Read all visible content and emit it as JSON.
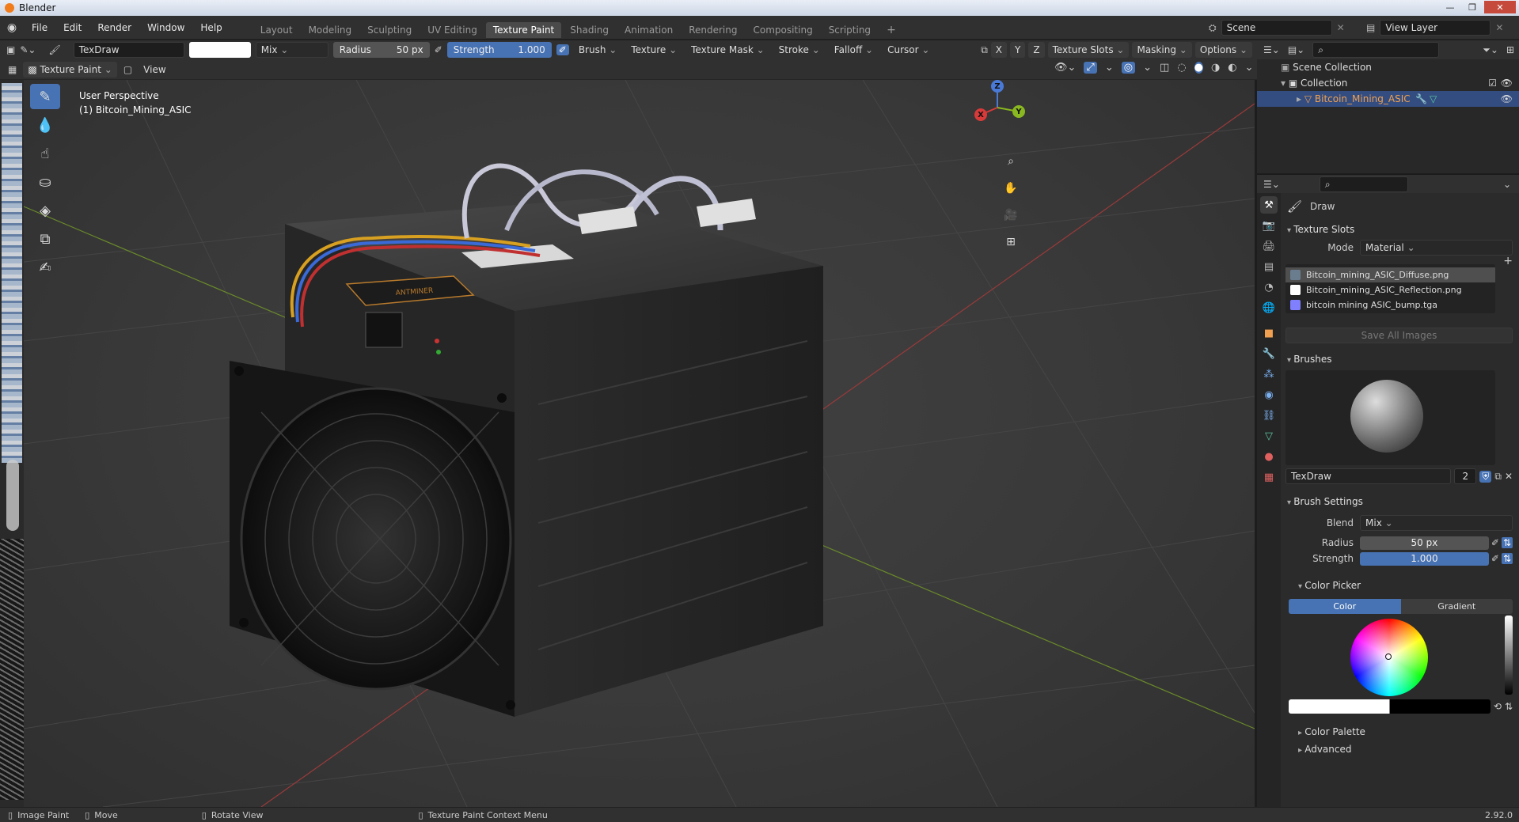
{
  "app": {
    "title": "Blender",
    "version": "2.92.0"
  },
  "window_buttons": [
    "—",
    "❐",
    "✕"
  ],
  "menu": [
    "File",
    "Edit",
    "Render",
    "Window",
    "Help"
  ],
  "workspaces": [
    "Layout",
    "Modeling",
    "Sculpting",
    "UV Editing",
    "Texture Paint",
    "Shading",
    "Animation",
    "Rendering",
    "Compositing",
    "Scripting"
  ],
  "active_workspace": "Texture Paint",
  "scene": "Scene",
  "view_layer": "View Layer",
  "tool_header": {
    "brush_name": "TexDraw",
    "blend": "Mix",
    "radius_label": "Radius",
    "radius_value": "50 px",
    "strength_label": "Strength",
    "strength_value": "1.000",
    "menus": [
      "Brush",
      "Texture",
      "Texture Mask",
      "Stroke",
      "Falloff",
      "Cursor"
    ],
    "axes": [
      "X",
      "Y",
      "Z"
    ],
    "right_menus": [
      "Texture Slots",
      "Masking",
      "Options"
    ]
  },
  "mode_header": {
    "mode": "Texture Paint",
    "view": "View"
  },
  "viewport": {
    "perspective": "User Perspective",
    "object_label": "(1) Bitcoin_Mining_ASIC",
    "brand_plate": "ANTMINER",
    "gizmo_axes": {
      "x": "X",
      "y": "Y",
      "z": "Z"
    }
  },
  "outliner": {
    "scene_collection": "Scene Collection",
    "collection": "Collection",
    "object": "Bitcoin_Mining_ASIC"
  },
  "properties": {
    "tool_name": "Draw",
    "texture_slots": {
      "title": "Texture Slots",
      "mode_label": "Mode",
      "mode_value": "Material",
      "slots": [
        {
          "name": "Bitcoin_mining_ASIC_Diffuse.png",
          "color": "#6a7d8f"
        },
        {
          "name": "Bitcoin_mining_ASIC_Reflection.png",
          "color": "#ffffff"
        },
        {
          "name": "bitcoin mining ASIC_bump.tga",
          "color": "#8080ff"
        }
      ],
      "save_all": "Save All Images"
    },
    "brushes": {
      "title": "Brushes",
      "name": "TexDraw",
      "users": "2"
    },
    "brush_settings": {
      "title": "Brush Settings",
      "blend_label": "Blend",
      "blend_value": "Mix",
      "radius_label": "Radius",
      "radius_value": "50 px",
      "strength_label": "Strength",
      "strength_value": "1.000"
    },
    "color_picker": {
      "title": "Color Picker",
      "tab_color": "Color",
      "tab_gradient": "Gradient"
    },
    "color_palette": "Color Palette",
    "advanced": "Advanced"
  },
  "statusbar": {
    "items": [
      "Image Paint",
      "Move",
      "Rotate View",
      "Texture Paint Context Menu"
    ]
  },
  "colors": {
    "accent": "#4772b3",
    "selected_object": "#f0a050"
  }
}
